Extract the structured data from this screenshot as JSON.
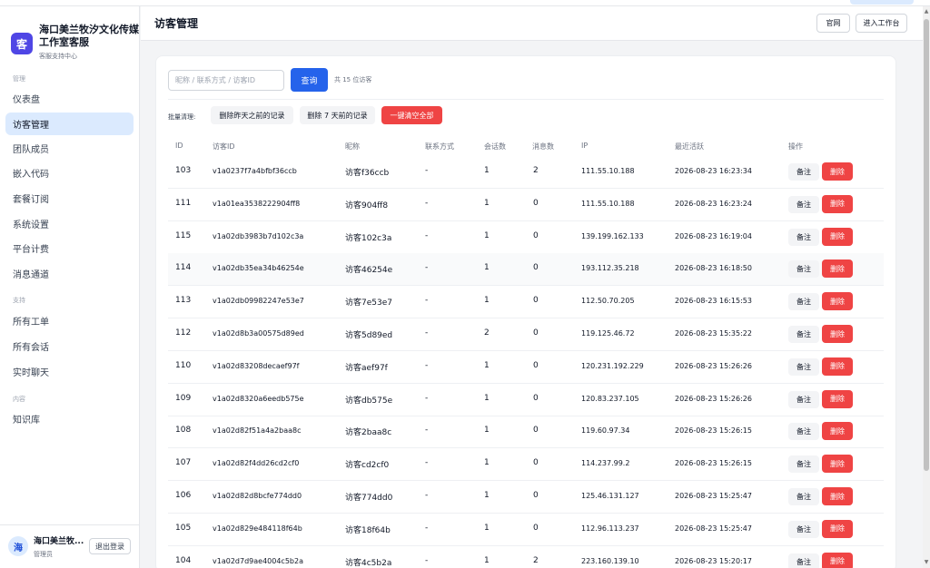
{
  "brand": {
    "logo_char": "客",
    "name": "海口美兰牧汐文化传媒工作室客服",
    "subtitle": "客服支持中心"
  },
  "sidebar": {
    "sections": [
      {
        "label": "管理",
        "items": [
          {
            "label": "仪表盘",
            "active": false
          },
          {
            "label": "访客管理",
            "active": true
          },
          {
            "label": "团队成员",
            "active": false
          },
          {
            "label": "嵌入代码",
            "active": false
          },
          {
            "label": "套餐订阅",
            "active": false
          },
          {
            "label": "系统设置",
            "active": false
          },
          {
            "label": "平台计费",
            "active": false
          },
          {
            "label": "消息通道",
            "active": false
          }
        ]
      },
      {
        "label": "支持",
        "items": [
          {
            "label": "所有工单",
            "active": false
          },
          {
            "label": "所有会话",
            "active": false
          },
          {
            "label": "实时聊天",
            "active": false
          }
        ]
      },
      {
        "label": "内容",
        "items": [
          {
            "label": "知识库",
            "active": false
          }
        ]
      }
    ]
  },
  "user": {
    "avatar_char": "海",
    "name": "海口美兰牧...",
    "role": "管理员",
    "logout_label": "退出登录"
  },
  "header": {
    "title": "访客管理",
    "website_label": "官网",
    "workspace_label": "进入工作台"
  },
  "search": {
    "placeholder": "昵称 / 联系方式 / 访客ID",
    "value": "",
    "button_label": "查询",
    "count_text": "共 15 位访客"
  },
  "batch": {
    "label": "批量清理:",
    "btn_yesterday": "删除昨天之前的记录",
    "btn_7days": "删除 7 天前的记录",
    "btn_clear_all": "一键清空全部"
  },
  "table": {
    "headers": {
      "id": "ID",
      "visitor_id": "访客ID",
      "nickname": "昵称",
      "contact": "联系方式",
      "sessions": "会话数",
      "messages": "消息数",
      "ip": "IP",
      "last_active": "最近活跃",
      "actions": "操作"
    },
    "note_label": "备注",
    "delete_label": "删除",
    "rows": [
      {
        "id": "103",
        "visitor_id": "v1a0237f7a4bfbf36ccb",
        "nickname": "访客f36ccb",
        "contact": "-",
        "sessions": "1",
        "messages": "2",
        "ip": "111.55.10.188",
        "last_active": "2026-08-23 16:23:34"
      },
      {
        "id": "111",
        "visitor_id": "v1a01ea3538222904ff8",
        "nickname": "访客904ff8",
        "contact": "-",
        "sessions": "1",
        "messages": "0",
        "ip": "111.55.10.188",
        "last_active": "2026-08-23 16:23:24"
      },
      {
        "id": "115",
        "visitor_id": "v1a02db3983b7d102c3a",
        "nickname": "访客102c3a",
        "contact": "-",
        "sessions": "1",
        "messages": "0",
        "ip": "139.199.162.133",
        "last_active": "2026-08-23 16:19:04"
      },
      {
        "id": "114",
        "visitor_id": "v1a02db35ea34b46254e",
        "nickname": "访客46254e",
        "contact": "-",
        "sessions": "1",
        "messages": "0",
        "ip": "193.112.35.218",
        "last_active": "2026-08-23 16:18:50"
      },
      {
        "id": "113",
        "visitor_id": "v1a02db09982247e53e7",
        "nickname": "访客7e53e7",
        "contact": "-",
        "sessions": "1",
        "messages": "0",
        "ip": "112.50.70.205",
        "last_active": "2026-08-23 16:15:53"
      },
      {
        "id": "112",
        "visitor_id": "v1a02d8b3a00575d89ed",
        "nickname": "访客5d89ed",
        "contact": "-",
        "sessions": "2",
        "messages": "0",
        "ip": "119.125.46.72",
        "last_active": "2026-08-23 15:35:22"
      },
      {
        "id": "110",
        "visitor_id": "v1a02d83208decaef97f",
        "nickname": "访客aef97f",
        "contact": "-",
        "sessions": "1",
        "messages": "0",
        "ip": "120.231.192.229",
        "last_active": "2026-08-23 15:26:26"
      },
      {
        "id": "109",
        "visitor_id": "v1a02d8320a6eedb575e",
        "nickname": "访客db575e",
        "contact": "-",
        "sessions": "1",
        "messages": "0",
        "ip": "120.83.237.105",
        "last_active": "2026-08-23 15:26:26"
      },
      {
        "id": "108",
        "visitor_id": "v1a02d82f51a4a2baa8c",
        "nickname": "访客2baa8c",
        "contact": "-",
        "sessions": "1",
        "messages": "0",
        "ip": "119.60.97.34",
        "last_active": "2026-08-23 15:26:15"
      },
      {
        "id": "107",
        "visitor_id": "v1a02d82f4dd26cd2cf0",
        "nickname": "访客cd2cf0",
        "contact": "-",
        "sessions": "1",
        "messages": "0",
        "ip": "114.237.99.2",
        "last_active": "2026-08-23 15:26:15"
      },
      {
        "id": "106",
        "visitor_id": "v1a02d82d8bcfe774dd0",
        "nickname": "访客774dd0",
        "contact": "-",
        "sessions": "1",
        "messages": "0",
        "ip": "125.46.131.127",
        "last_active": "2026-08-23 15:25:47"
      },
      {
        "id": "105",
        "visitor_id": "v1a02d829e484118f64b",
        "nickname": "访客18f64b",
        "contact": "-",
        "sessions": "1",
        "messages": "0",
        "ip": "112.96.113.237",
        "last_active": "2026-08-23 15:25:47"
      },
      {
        "id": "104",
        "visitor_id": "v1a02d7d9ae4004c5b2a",
        "nickname": "访客4c5b2a",
        "contact": "-",
        "sessions": "1",
        "messages": "2",
        "ip": "223.160.139.10",
        "last_active": "2026-08-23 15:20:17"
      }
    ]
  },
  "colors": {
    "primary": "#2563eb",
    "danger": "#ef4444",
    "active_nav": "#dbeafe",
    "brand_logo": "#4f46e5"
  }
}
